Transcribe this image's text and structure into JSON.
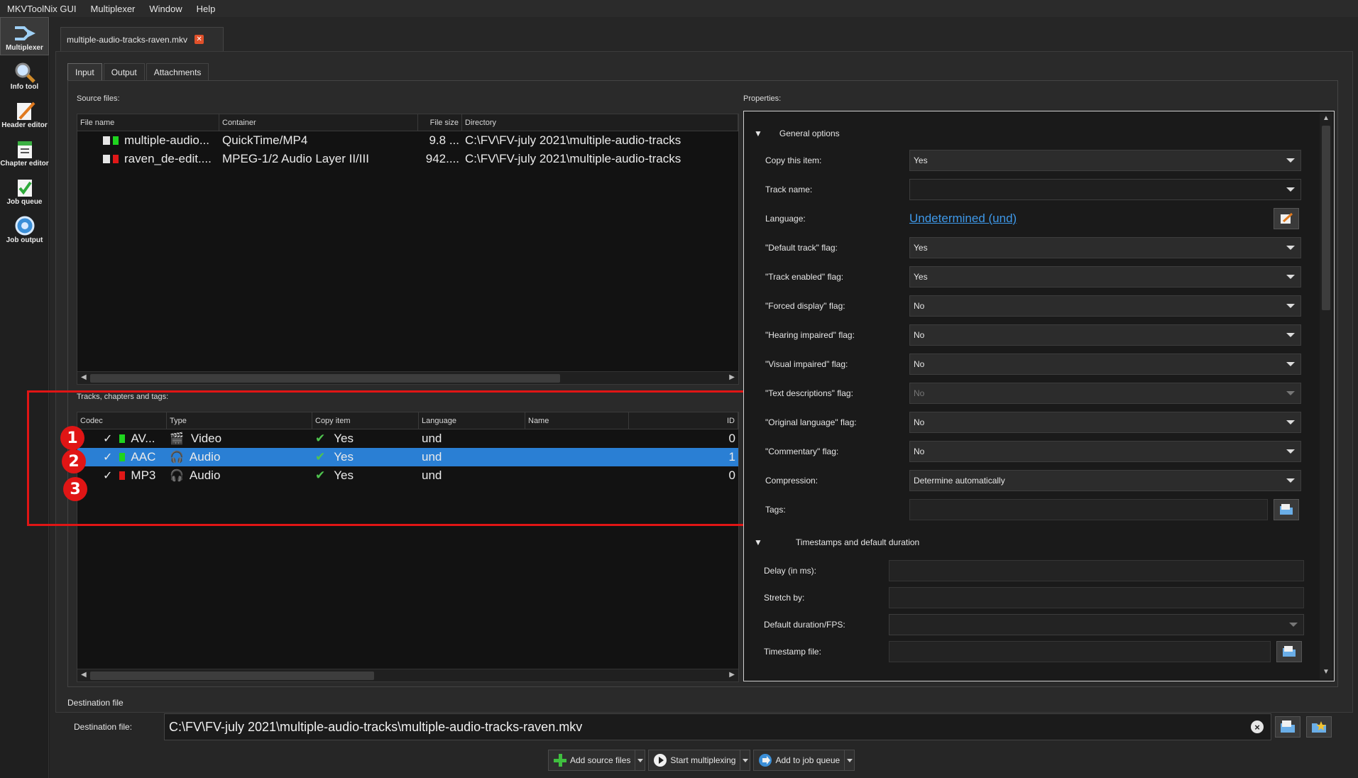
{
  "menubar": [
    "MKVToolNix GUI",
    "Multiplexer",
    "Window",
    "Help"
  ],
  "sidebar": [
    {
      "label": "Multiplexer",
      "icon": "multiplexer-icon",
      "active": true
    },
    {
      "label": "Info tool",
      "icon": "info-tool-icon"
    },
    {
      "label": "Header editor",
      "icon": "header-editor-icon"
    },
    {
      "label": "Chapter editor",
      "icon": "chapter-editor-icon"
    },
    {
      "label": "Job queue",
      "icon": "job-queue-icon"
    },
    {
      "label": "Job output",
      "icon": "job-output-icon"
    }
  ],
  "doc_tab": {
    "title": "multiple-audio-tracks-raven.mkv",
    "close": "✕"
  },
  "subtabs": [
    "Input",
    "Output",
    "Attachments"
  ],
  "source_files": {
    "label": "Source files:",
    "columns": [
      "File name",
      "Container",
      "File size",
      "Directory"
    ],
    "rows": [
      {
        "name": "multiple-audio...",
        "container": "QuickTime/MP4",
        "size": "9.8 ...",
        "dir": "C:\\FV\\FV-july 2021\\multiple-audio-tracks",
        "color": "#1fd41f"
      },
      {
        "name": "raven_de-edit....",
        "container": "MPEG-1/2 Audio Layer II/III",
        "size": "942....",
        "dir": "C:\\FV\\FV-july 2021\\multiple-audio-tracks",
        "color": "#e01818"
      }
    ]
  },
  "tracks": {
    "label": "Tracks, chapters and tags:",
    "columns": [
      "Codec",
      "Type",
      "Copy item",
      "Language",
      "Name",
      "ID"
    ],
    "rows": [
      {
        "codec": "AV...",
        "type": "Video",
        "copy": "Yes",
        "lang": "und",
        "name": "",
        "id": "0",
        "color": "#1fd41f",
        "selected": false,
        "badge": "1"
      },
      {
        "codec": "AAC",
        "type": "Audio",
        "copy": "Yes",
        "lang": "und",
        "name": "",
        "id": "1",
        "color": "#1fd41f",
        "selected": true,
        "badge": "2"
      },
      {
        "codec": "MP3",
        "type": "Audio",
        "copy": "Yes",
        "lang": "und",
        "name": "",
        "id": "0",
        "color": "#e01818",
        "selected": false,
        "badge": "3"
      }
    ]
  },
  "properties": {
    "label": "Properties:",
    "general_header": "General options",
    "copy_item": {
      "label": "Copy this item:",
      "value": "Yes"
    },
    "track_name": {
      "label": "Track name:",
      "value": ""
    },
    "language": {
      "label": "Language:",
      "value": "Undetermined (und)"
    },
    "default_track": {
      "label": "\"Default track\" flag:",
      "value": "Yes"
    },
    "track_enabled": {
      "label": "\"Track enabled\" flag:",
      "value": "Yes"
    },
    "forced_display": {
      "label": "\"Forced display\" flag:",
      "value": "No"
    },
    "hearing_impaired": {
      "label": "\"Hearing impaired\" flag:",
      "value": "No"
    },
    "visual_impaired": {
      "label": "\"Visual impaired\" flag:",
      "value": "No"
    },
    "text_descriptions": {
      "label": "\"Text descriptions\" flag:",
      "value": "No"
    },
    "original_language": {
      "label": "\"Original language\" flag:",
      "value": "No"
    },
    "commentary": {
      "label": "\"Commentary\" flag:",
      "value": "No"
    },
    "compression": {
      "label": "Compression:",
      "value": "Determine automatically"
    },
    "tags": {
      "label": "Tags:",
      "value": ""
    },
    "timestamps_header": "Timestamps and default duration",
    "delay": {
      "label": "Delay (in ms):",
      "value": ""
    },
    "stretch": {
      "label": "Stretch by:",
      "value": ""
    },
    "default_duration": {
      "label": "Default duration/FPS:",
      "value": ""
    },
    "timestamp_file": {
      "label": "Timestamp file:",
      "value": ""
    }
  },
  "destination": {
    "section_label": "Destination file",
    "field_label": "Destination file:",
    "value": "C:\\FV\\FV-july 2021\\multiple-audio-tracks\\multiple-audio-tracks-raven.mkv",
    "clear": "×"
  },
  "buttons": {
    "add_source": "Add source files",
    "start": "Start multiplexing",
    "add_queue": "Add to job queue"
  },
  "colors": {
    "accent": "#2a7fd4",
    "highlight": "#e01515",
    "link": "#3e98e8"
  }
}
